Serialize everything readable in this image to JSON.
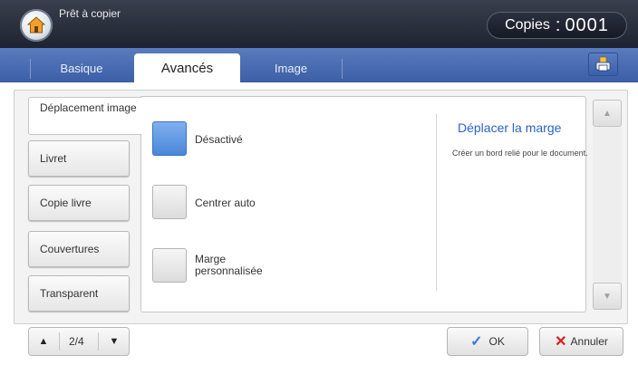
{
  "header": {
    "status": "Prêt à copier",
    "copies_label": "Copies",
    "copies_sep": ":",
    "copies_value": "0001"
  },
  "tabs": [
    {
      "label": "Basique",
      "active": false
    },
    {
      "label": "Avancés",
      "active": true
    },
    {
      "label": "Image",
      "active": false
    }
  ],
  "sidebar": {
    "items": [
      {
        "label": "Déplacement image",
        "active": true
      },
      {
        "label": "Livret",
        "active": false
      },
      {
        "label": "Copie livre",
        "active": false
      },
      {
        "label": "Couvertures",
        "active": false
      },
      {
        "label": "Transparent",
        "active": false
      }
    ]
  },
  "options": [
    {
      "label": "Désactivé",
      "selected": true
    },
    {
      "label": "Centrer auto",
      "selected": false
    },
    {
      "label": "Marge personnalisée",
      "selected": false
    }
  ],
  "info": {
    "title": "Déplacer la marge",
    "description": "Créer un bord relié pour le document."
  },
  "pager": {
    "text": "2/4"
  },
  "actions": {
    "ok_label": "OK",
    "cancel_label": "Annuler"
  },
  "colors": {
    "accent": "#3b5ea6",
    "selected": "#4a86d8",
    "info_title": "#2a63c5",
    "cancel_x": "#d62020",
    "ok_check": "#3a78d8"
  }
}
